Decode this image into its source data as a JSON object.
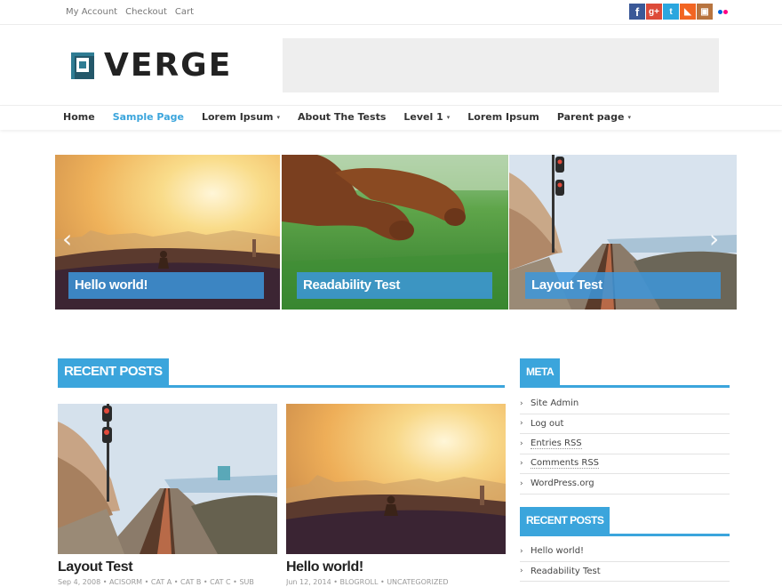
{
  "topbar": {
    "links": [
      "My Account",
      "Checkout",
      "Cart"
    ],
    "social": [
      {
        "icon": "facebook-icon",
        "glyph": "f",
        "color": "#3b5998"
      },
      {
        "icon": "google-plus-icon",
        "glyph": "g+",
        "color": "#dd4b39"
      },
      {
        "icon": "twitter-icon",
        "glyph": "t",
        "color": "#2ba6de"
      },
      {
        "icon": "rss-icon",
        "glyph": "◣",
        "color": "#f26522"
      },
      {
        "icon": "instagram-icon",
        "glyph": "▣",
        "color": "#b8743f"
      },
      {
        "icon": "flickr-icon",
        "glyph": "",
        "color": "#ff0084"
      }
    ]
  },
  "header": {
    "logo_text": "VERGE"
  },
  "nav": {
    "items": [
      {
        "label": "Home",
        "dropdown": false,
        "active": false
      },
      {
        "label": "Sample Page",
        "dropdown": false,
        "active": true
      },
      {
        "label": "Lorem Ipsum",
        "dropdown": true,
        "active": false
      },
      {
        "label": "About The Tests",
        "dropdown": false,
        "active": false
      },
      {
        "label": "Level 1",
        "dropdown": true,
        "active": false
      },
      {
        "label": "Lorem Ipsum",
        "dropdown": false,
        "active": false
      },
      {
        "label": "Parent page",
        "dropdown": true,
        "active": false
      }
    ]
  },
  "slider": {
    "slides": [
      {
        "caption": "Hello world!"
      },
      {
        "caption": "Readability Test"
      },
      {
        "caption": "Layout Test"
      }
    ],
    "prev_glyph": "‹",
    "next_glyph": "›"
  },
  "recent_posts": {
    "heading": "RECENT POSTS",
    "posts": [
      {
        "title": "Layout Test",
        "meta": "Sep 4, 2008  •  ACISORM • CAT A • CAT B • CAT C • SUB"
      },
      {
        "title": "Hello world!",
        "meta": "Jun 12, 2014  •  BLOGROLL • UNCATEGORIZED"
      }
    ]
  },
  "sidebar": {
    "meta": {
      "heading": "META",
      "items": [
        "Site Admin",
        "Log out",
        "Entries RSS",
        "Comments RSS",
        "WordPress.org"
      ]
    },
    "recent": {
      "heading": "RECENT POSTS",
      "items": [
        "Hello world!",
        "Readability Test"
      ]
    }
  },
  "colors": {
    "accent": "#3ba5dc",
    "logo": "#2f7c93"
  }
}
